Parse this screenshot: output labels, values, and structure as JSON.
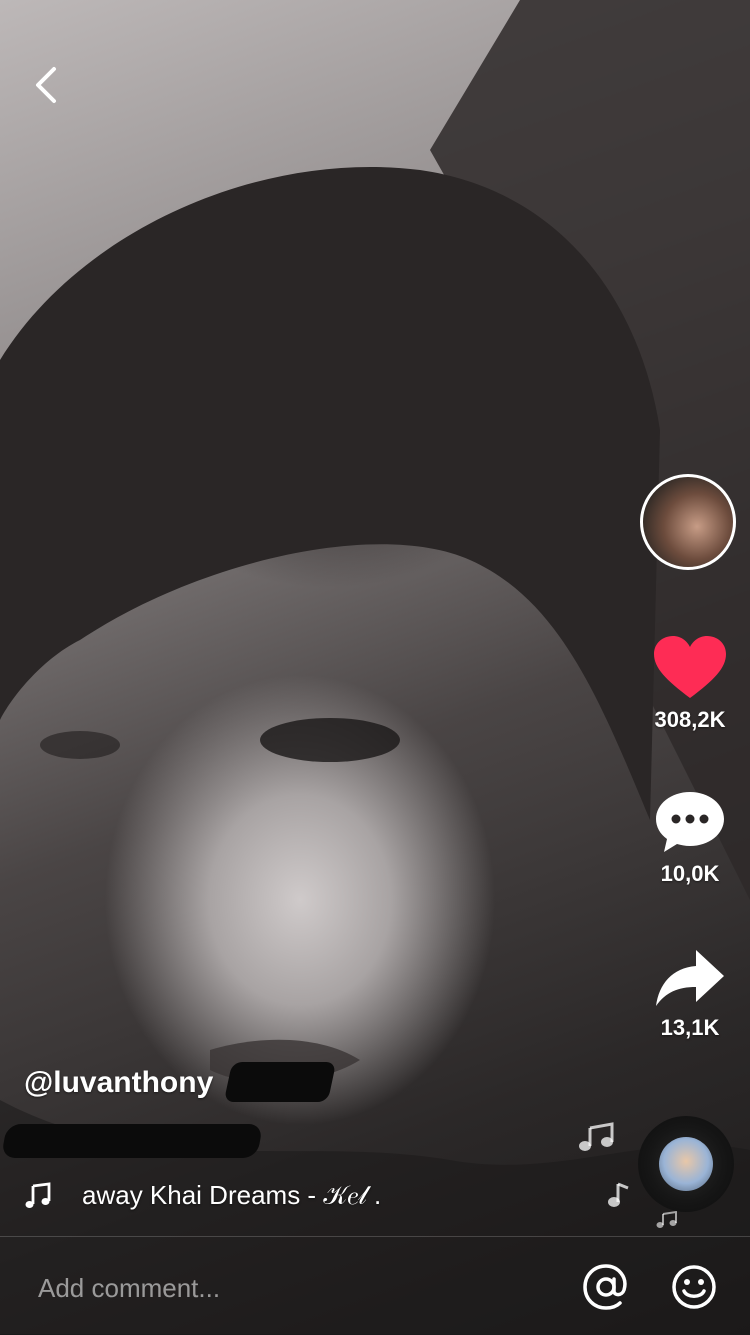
{
  "username": "@luvanthony",
  "stats": {
    "likes": "308,2K",
    "comments": "10,0K",
    "shares": "13,1K"
  },
  "music": {
    "text": "away Khai Dreams - 𝒦𝑒𝓁 ."
  },
  "comment_bar": {
    "placeholder": "Add comment..."
  },
  "icons": {
    "back": "back-chevron-icon",
    "like": "heart-icon",
    "comment": "comment-bubble-icon",
    "share": "share-arrow-icon",
    "music": "music-note-icon",
    "mention": "at-sign-icon",
    "emoji": "emoji-icon"
  },
  "colors": {
    "like": "#fe2c55",
    "text": "#ffffff"
  }
}
